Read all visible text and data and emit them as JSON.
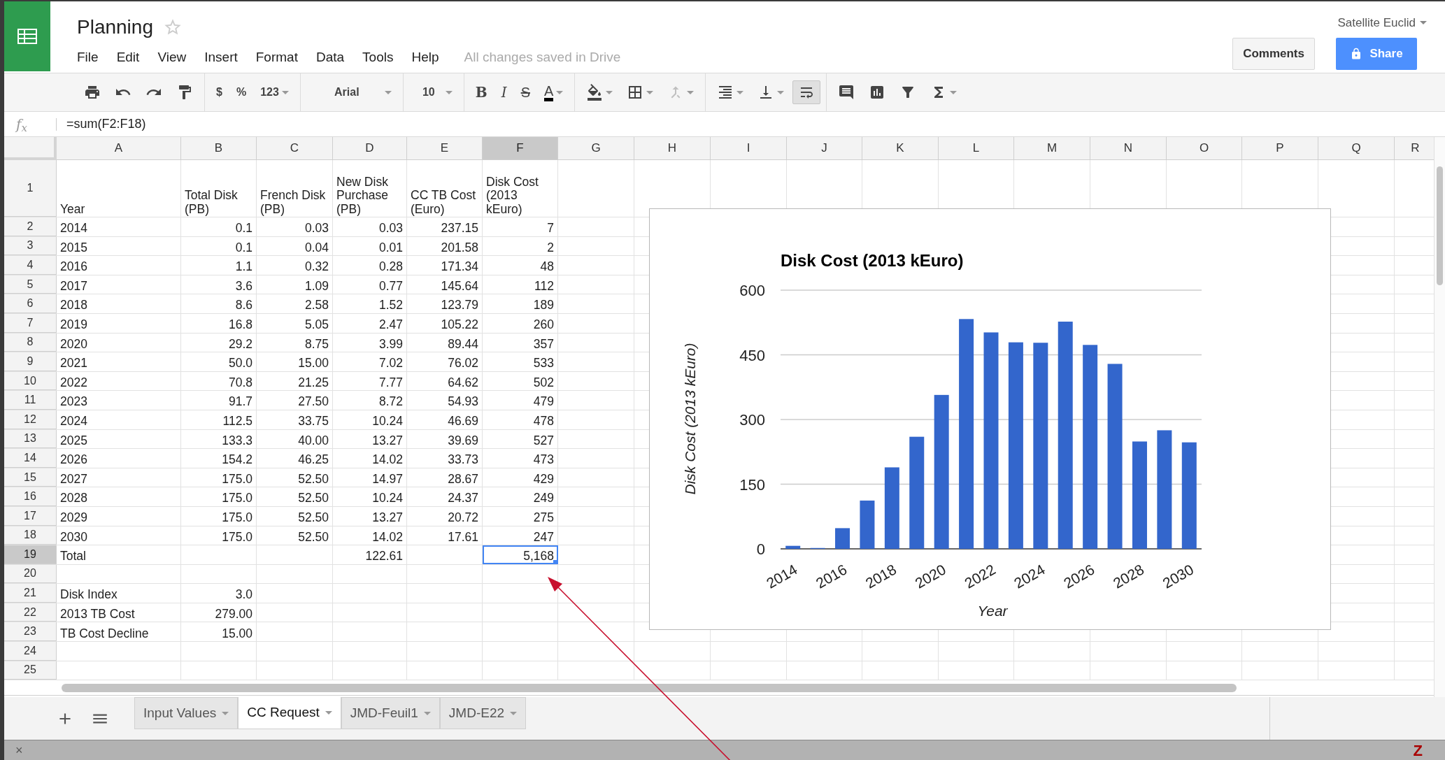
{
  "document": {
    "title": "Planning",
    "starred": false
  },
  "menu": [
    "File",
    "Edit",
    "View",
    "Insert",
    "Format",
    "Data",
    "Tools",
    "Help"
  ],
  "save_status": "All changes saved in Drive",
  "account": "Satellite Euclid",
  "buttons": {
    "comments": "Comments",
    "share": "Share"
  },
  "toolbar": [
    [
      {
        "kind": "print",
        "dropdown": false,
        "pressed": false,
        "disabled": false
      },
      {
        "kind": "undo",
        "dropdown": false,
        "pressed": false,
        "disabled": false
      },
      {
        "kind": "redo",
        "dropdown": false,
        "pressed": false,
        "disabled": false
      },
      {
        "kind": "paint",
        "dropdown": false,
        "pressed": false,
        "disabled": false
      }
    ],
    [
      {
        "kind": "currency",
        "text": "$",
        "dropdown": false,
        "pressed": false,
        "disabled": false
      },
      {
        "kind": "percent",
        "text": "%",
        "dropdown": false,
        "pressed": false,
        "disabled": false
      },
      {
        "kind": "number",
        "text": "123",
        "dropdown": true,
        "pressed": false,
        "disabled": false
      }
    ],
    [
      {
        "kind": "font",
        "text": "Arial",
        "dropdown": true,
        "pressed": false,
        "disabled": false
      }
    ],
    [
      {
        "kind": "size",
        "text": "10",
        "dropdown": true,
        "pressed": false,
        "disabled": false
      }
    ],
    [
      {
        "kind": "bold",
        "text": "B",
        "dropdown": false,
        "pressed": false,
        "disabled": false
      },
      {
        "kind": "italic",
        "text": "I",
        "dropdown": false,
        "pressed": false,
        "disabled": false
      },
      {
        "kind": "strike",
        "text": "S",
        "dropdown": false,
        "pressed": false,
        "disabled": false
      },
      {
        "kind": "color",
        "text": "A",
        "dropdown": true,
        "pressed": false,
        "disabled": false
      }
    ],
    [
      {
        "kind": "fill",
        "dropdown": true,
        "pressed": false,
        "disabled": false
      },
      {
        "kind": "borders",
        "dropdown": true,
        "pressed": false,
        "disabled": false
      },
      {
        "kind": "merge",
        "dropdown": true,
        "pressed": false,
        "disabled": true
      }
    ],
    [
      {
        "kind": "align",
        "dropdown": true,
        "pressed": false,
        "disabled": false
      },
      {
        "kind": "valign",
        "dropdown": true,
        "pressed": false,
        "disabled": false
      },
      {
        "kind": "wrap",
        "dropdown": false,
        "pressed": true,
        "disabled": false
      }
    ],
    [
      {
        "kind": "comment",
        "dropdown": false,
        "pressed": false,
        "disabled": false
      },
      {
        "kind": "chart",
        "dropdown": false,
        "pressed": false,
        "disabled": false
      },
      {
        "kind": "filter",
        "dropdown": false,
        "pressed": false,
        "disabled": false
      },
      {
        "kind": "functions",
        "dropdown": true,
        "pressed": false,
        "disabled": false
      }
    ]
  ],
  "formula_bar": {
    "label": "f$_{x}$",
    "formula": "=sum(F2:F18)"
  },
  "columns": [
    {
      "label": "A",
      "selected": false
    },
    {
      "label": "B",
      "selected": false
    },
    {
      "label": "C",
      "selected": false
    },
    {
      "label": "D",
      "selected": false
    },
    {
      "label": "E",
      "selected": false
    },
    {
      "label": "F",
      "selected": true
    },
    {
      "label": "G",
      "selected": false
    },
    {
      "label": "H",
      "selected": false
    },
    {
      "label": "I",
      "selected": false
    },
    {
      "label": "J",
      "selected": false
    },
    {
      "label": "K",
      "selected": false
    },
    {
      "label": "L",
      "selected": false
    },
    {
      "label": "M",
      "selected": false
    },
    {
      "label": "N",
      "selected": false
    },
    {
      "label": "O",
      "selected": false
    },
    {
      "label": "P",
      "selected": false
    },
    {
      "label": "Q",
      "selected": false
    },
    {
      "label": "R",
      "selected": false
    }
  ],
  "rows": [
    {
      "number": "1",
      "kind": "header",
      "selected": false,
      "cells": [
        {
          "text": "Year"
        },
        {
          "text": "Total Disk (PB)"
        },
        {
          "text": "French Disk (PB)"
        },
        {
          "text": "New Disk Purchase (PB)"
        },
        {
          "text": "CC TB Cost (Euro)"
        },
        {
          "text": "Disk Cost (2013 kEuro)"
        }
      ]
    },
    {
      "number": "2",
      "kind": "data",
      "selected": false,
      "cells": [
        {
          "text": "2014"
        },
        {
          "text": "0.1"
        },
        {
          "text": "0.03"
        },
        {
          "text": "0.03"
        },
        {
          "text": "237.15"
        },
        {
          "text": "7"
        }
      ]
    },
    {
      "number": "3",
      "kind": "data",
      "selected": false,
      "cells": [
        {
          "text": "2015"
        },
        {
          "text": "0.1"
        },
        {
          "text": "0.04"
        },
        {
          "text": "0.01"
        },
        {
          "text": "201.58"
        },
        {
          "text": "2"
        }
      ]
    },
    {
      "number": "4",
      "kind": "data",
      "selected": false,
      "cells": [
        {
          "text": "2016"
        },
        {
          "text": "1.1"
        },
        {
          "text": "0.32"
        },
        {
          "text": "0.28"
        },
        {
          "text": "171.34"
        },
        {
          "text": "48"
        }
      ]
    },
    {
      "number": "5",
      "kind": "data",
      "selected": false,
      "cells": [
        {
          "text": "2017"
        },
        {
          "text": "3.6"
        },
        {
          "text": "1.09"
        },
        {
          "text": "0.77"
        },
        {
          "text": "145.64"
        },
        {
          "text": "112"
        }
      ]
    },
    {
      "number": "6",
      "kind": "data",
      "selected": false,
      "cells": [
        {
          "text": "2018"
        },
        {
          "text": "8.6"
        },
        {
          "text": "2.58"
        },
        {
          "text": "1.52"
        },
        {
          "text": "123.79"
        },
        {
          "text": "189"
        }
      ]
    },
    {
      "number": "7",
      "kind": "data",
      "selected": false,
      "cells": [
        {
          "text": "2019"
        },
        {
          "text": "16.8"
        },
        {
          "text": "5.05"
        },
        {
          "text": "2.47"
        },
        {
          "text": "105.22"
        },
        {
          "text": "260"
        }
      ]
    },
    {
      "number": "8",
      "kind": "data",
      "selected": false,
      "cells": [
        {
          "text": "2020"
        },
        {
          "text": "29.2"
        },
        {
          "text": "8.75"
        },
        {
          "text": "3.99"
        },
        {
          "text": "89.44"
        },
        {
          "text": "357"
        }
      ]
    },
    {
      "number": "9",
      "kind": "data",
      "selected": false,
      "cells": [
        {
          "text": "2021"
        },
        {
          "text": "50.0"
        },
        {
          "text": "15.00"
        },
        {
          "text": "7.02"
        },
        {
          "text": "76.02"
        },
        {
          "text": "533"
        }
      ]
    },
    {
      "number": "10",
      "kind": "data",
      "selected": false,
      "cells": [
        {
          "text": "2022"
        },
        {
          "text": "70.8"
        },
        {
          "text": "21.25"
        },
        {
          "text": "7.77"
        },
        {
          "text": "64.62"
        },
        {
          "text": "502"
        }
      ]
    },
    {
      "number": "11",
      "kind": "data",
      "selected": false,
      "cells": [
        {
          "text": "2023"
        },
        {
          "text": "91.7"
        },
        {
          "text": "27.50"
        },
        {
          "text": "8.72"
        },
        {
          "text": "54.93"
        },
        {
          "text": "479"
        }
      ]
    },
    {
      "number": "12",
      "kind": "data",
      "selected": false,
      "cells": [
        {
          "text": "2024"
        },
        {
          "text": "112.5"
        },
        {
          "text": "33.75"
        },
        {
          "text": "10.24"
        },
        {
          "text": "46.69"
        },
        {
          "text": "478"
        }
      ]
    },
    {
      "number": "13",
      "kind": "data",
      "selected": false,
      "cells": [
        {
          "text": "2025"
        },
        {
          "text": "133.3"
        },
        {
          "text": "40.00"
        },
        {
          "text": "13.27"
        },
        {
          "text": "39.69"
        },
        {
          "text": "527"
        }
      ]
    },
    {
      "number": "14",
      "kind": "data",
      "selected": false,
      "cells": [
        {
          "text": "2026"
        },
        {
          "text": "154.2"
        },
        {
          "text": "46.25"
        },
        {
          "text": "14.02"
        },
        {
          "text": "33.73"
        },
        {
          "text": "473"
        }
      ]
    },
    {
      "number": "15",
      "kind": "data",
      "selected": false,
      "cells": [
        {
          "text": "2027"
        },
        {
          "text": "175.0"
        },
        {
          "text": "52.50"
        },
        {
          "text": "14.97"
        },
        {
          "text": "28.67"
        },
        {
          "text": "429"
        }
      ]
    },
    {
      "number": "16",
      "kind": "data",
      "selected": false,
      "cells": [
        {
          "text": "2028"
        },
        {
          "text": "175.0"
        },
        {
          "text": "52.50"
        },
        {
          "text": "10.24"
        },
        {
          "text": "24.37"
        },
        {
          "text": "249"
        }
      ]
    },
    {
      "number": "17",
      "kind": "data",
      "selected": false,
      "cells": [
        {
          "text": "2029"
        },
        {
          "text": "175.0"
        },
        {
          "text": "52.50"
        },
        {
          "text": "13.27"
        },
        {
          "text": "20.72"
        },
        {
          "text": "275"
        }
      ]
    },
    {
      "number": "18",
      "kind": "data",
      "selected": false,
      "cells": [
        {
          "text": "2030"
        },
        {
          "text": "175.0"
        },
        {
          "text": "52.50"
        },
        {
          "text": "14.02"
        },
        {
          "text": "17.61"
        },
        {
          "text": "247"
        }
      ]
    },
    {
      "number": "19",
      "kind": "data",
      "selected": true,
      "cells": [
        {
          "text": "Total"
        },
        {},
        {},
        {
          "text": "122.61"
        },
        {},
        {
          "text": "5,168"
        }
      ]
    },
    {
      "number": "20",
      "kind": "data",
      "selected": false
    },
    {
      "number": "21",
      "kind": "data",
      "selected": false,
      "cells": [
        {
          "text": "Disk Index"
        },
        {
          "text": "3.0"
        }
      ]
    },
    {
      "number": "22",
      "kind": "data",
      "selected": false,
      "cells": [
        {
          "text": "2013 TB Cost"
        },
        {
          "text": "279.00"
        }
      ]
    },
    {
      "number": "23",
      "kind": "data",
      "selected": false,
      "cells": [
        {
          "text": "TB Cost Decline"
        },
        {
          "text": "15.00"
        }
      ]
    },
    {
      "number": "24",
      "kind": "data",
      "selected": false
    },
    {
      "number": "25",
      "kind": "data",
      "selected": false
    }
  ],
  "chart": {
    "chart_data": {
      "type": "bar",
      "title": "Disk Cost (2013 kEuro)",
      "xlabel": "Year",
      "ylabel": "Disk Cost (2013 kEuro)",
      "x": [
        2014,
        2015,
        2016,
        2017,
        2018,
        2019,
        2020,
        2021,
        2022,
        2023,
        2024,
        2025,
        2026,
        2027,
        2028,
        2029,
        2030
      ],
      "values": [
        7,
        2,
        48,
        112,
        189,
        260,
        357,
        533,
        502,
        479,
        478,
        527,
        473,
        429,
        249,
        275,
        247
      ],
      "xlim": [
        2013.5,
        2030.5
      ],
      "ylim": [
        0,
        600
      ],
      "yticks": [
        0,
        150,
        300,
        450,
        600
      ],
      "grid": true,
      "xticks": [
        2014,
        2016,
        2018,
        2020,
        2022,
        2024,
        2026,
        2028,
        2030
      ]
    }
  },
  "sheet_tabs": [
    {
      "label": "Input Values",
      "selected": false
    },
    {
      "label": "CC Request",
      "selected": true
    },
    {
      "label": "JMD-Feuil1",
      "selected": false
    },
    {
      "label": "JMD-E22",
      "selected": false
    }
  ],
  "status_bar": {
    "close": "×",
    "badge": "Z"
  }
}
